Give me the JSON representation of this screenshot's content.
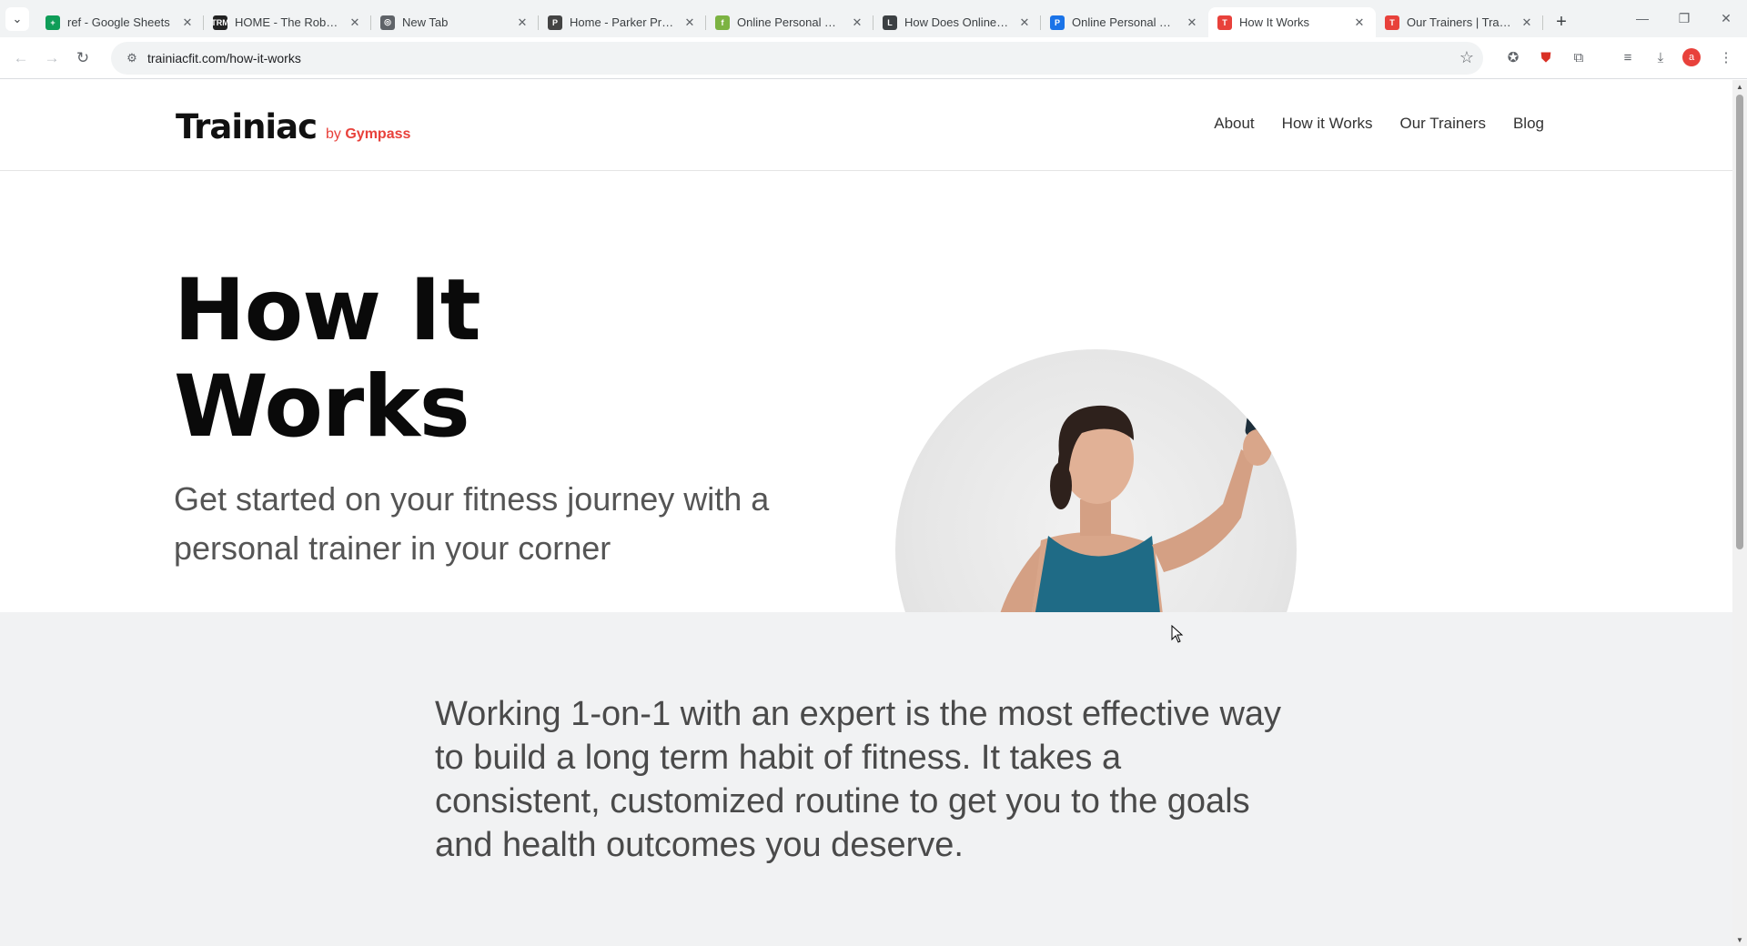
{
  "browser": {
    "tabs": [
      {
        "title": "ref - Google Sheets",
        "fav_color": "#0f9d58",
        "fav_glyph": "+",
        "active": false
      },
      {
        "title": "HOME - The Robards",
        "fav_color": "#222222",
        "fav_glyph": "TRM",
        "active": false
      },
      {
        "title": "New Tab",
        "fav_color": "#5f6368",
        "fav_glyph": "◎",
        "active": false
      },
      {
        "title": "Home - Parker Practic",
        "fav_color": "#444444",
        "fav_glyph": "P",
        "active": false
      },
      {
        "title": "Online Personal Train",
        "fav_color": "#7cb342",
        "fav_glyph": "f",
        "active": false
      },
      {
        "title": "How Does Online Pe",
        "fav_color": "#3c4043",
        "fav_glyph": "L",
        "active": false
      },
      {
        "title": "Online Personal Train",
        "fav_color": "#1a73e8",
        "fav_glyph": "P",
        "active": false
      },
      {
        "title": "How It Works",
        "fav_color": "#e8413b",
        "fav_glyph": "T",
        "active": true
      },
      {
        "title": "Our Trainers | Trainiac",
        "fav_color": "#e8413b",
        "fav_glyph": "T",
        "active": false
      }
    ],
    "url": "trainiacfit.com/how-it-works",
    "profile_initial": "a"
  },
  "site": {
    "logo_brand": "Trainiac",
    "logo_by": "by",
    "logo_partner": "Gympass",
    "nav": [
      "About",
      "How it Works",
      "Our Trainers",
      "Blog"
    ]
  },
  "hero": {
    "title_line1": "How It",
    "title_line2": "Works",
    "subtitle": "Get started on your fitness journey with a personal trainer in your corner"
  },
  "intro": {
    "text": "Working 1-on-1 with an expert is the most effective way to build a long term habit of fitness. It takes a consistent, customized routine to get you to the goals and health outcomes you deserve."
  }
}
